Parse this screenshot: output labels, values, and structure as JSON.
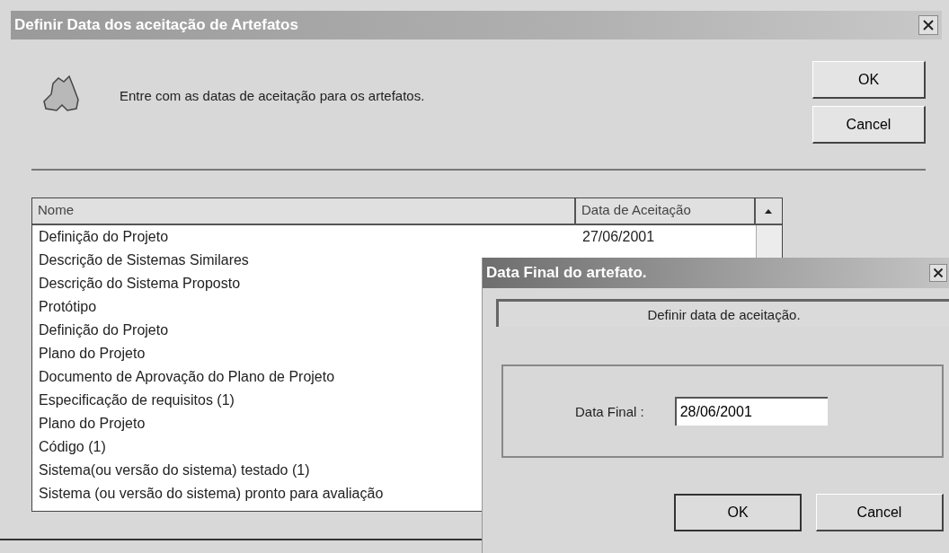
{
  "window": {
    "title": "Definir Data dos aceitação de Artefatos"
  },
  "message": "Entre com as datas de aceitação para os artefatos.",
  "buttons": [
    "OK",
    "Cancel"
  ],
  "table": {
    "columns": [
      "Nome",
      "Data de Aceitação"
    ],
    "rows": [
      {
        "name": "Definição do Projeto",
        "date": "27/06/2001"
      },
      {
        "name": "Descrição de Sistemas Similares"
      },
      {
        "name": "Descrição do Sistema Proposto"
      },
      {
        "name": "Protótipo"
      },
      {
        "name": "Definição do Projeto"
      },
      {
        "name": "Plano do Projeto"
      },
      {
        "name": "Documento de Aprovação do Plano de Projeto"
      },
      {
        "name": "Especificação de requisitos (1)"
      },
      {
        "name": "Plano do Projeto"
      },
      {
        "name": "Código (1)"
      },
      {
        "name": "Sistema(ou versão do sistema) testado (1)"
      },
      {
        "name": "Sistema (ou versão do sistema) pronto para avaliação"
      }
    ]
  },
  "dialog": {
    "title": "Data Final do artefato.",
    "heading": "Definir data de aceitação.",
    "field_label": "Data Final :",
    "field_value": "28/06/2001",
    "buttons": [
      "OK",
      "Cancel"
    ]
  }
}
